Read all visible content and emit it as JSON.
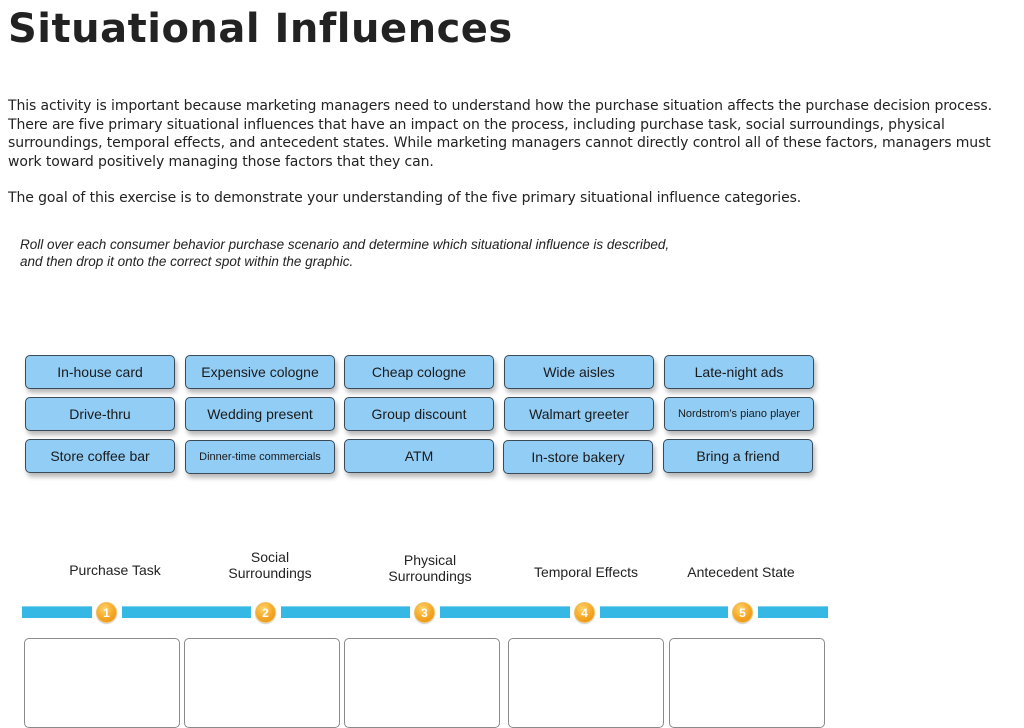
{
  "page": {
    "title": "Situational Influences",
    "intro_paragraphs": [
      "This activity is important because marketing managers need to understand how the purchase situation affects the purchase decision process. There are five primary situational influences that have an impact on the process, including purchase task, social surroundings, physical surroundings, temporal effects, and antecedent states. While marketing managers cannot directly control all of these factors, managers must work toward positively managing those factors that they can.",
      "The goal of this exercise is to demonstrate your understanding of the five primary situational influence categories."
    ],
    "instructions": "Roll over each consumer behavior purchase scenario and determine which situational influence is described, and then drop it onto the correct spot within the graphic."
  },
  "cards": [
    {
      "label": "In-house card"
    },
    {
      "label": "Expensive cologne"
    },
    {
      "label": "Cheap cologne"
    },
    {
      "label": "Wide aisles"
    },
    {
      "label": "Late-night ads"
    },
    {
      "label": "Drive-thru"
    },
    {
      "label": "Wedding present"
    },
    {
      "label": "Group discount"
    },
    {
      "label": "Walmart greeter"
    },
    {
      "label": "Nordstrom’s piano player"
    },
    {
      "label": "Store coffee bar"
    },
    {
      "label": "Dinner-time commercials"
    },
    {
      "label": "ATM"
    },
    {
      "label": "In-store bakery"
    },
    {
      "label": "Bring a friend"
    }
  ],
  "categories": [
    {
      "number": "1",
      "label_line1": "Purchase Task",
      "label_line2": ""
    },
    {
      "number": "2",
      "label_line1": "Social",
      "label_line2": "Surroundings"
    },
    {
      "number": "3",
      "label_line1": "Physical",
      "label_line2": "Surroundings"
    },
    {
      "number": "4",
      "label_line1": "Temporal Effects",
      "label_line2": ""
    },
    {
      "number": "5",
      "label_line1": "Antecedent State",
      "label_line2": ""
    }
  ],
  "colors": {
    "card_fill": "#92cdf6",
    "timeline": "#35b8e4",
    "badge": "#f6a623"
  }
}
